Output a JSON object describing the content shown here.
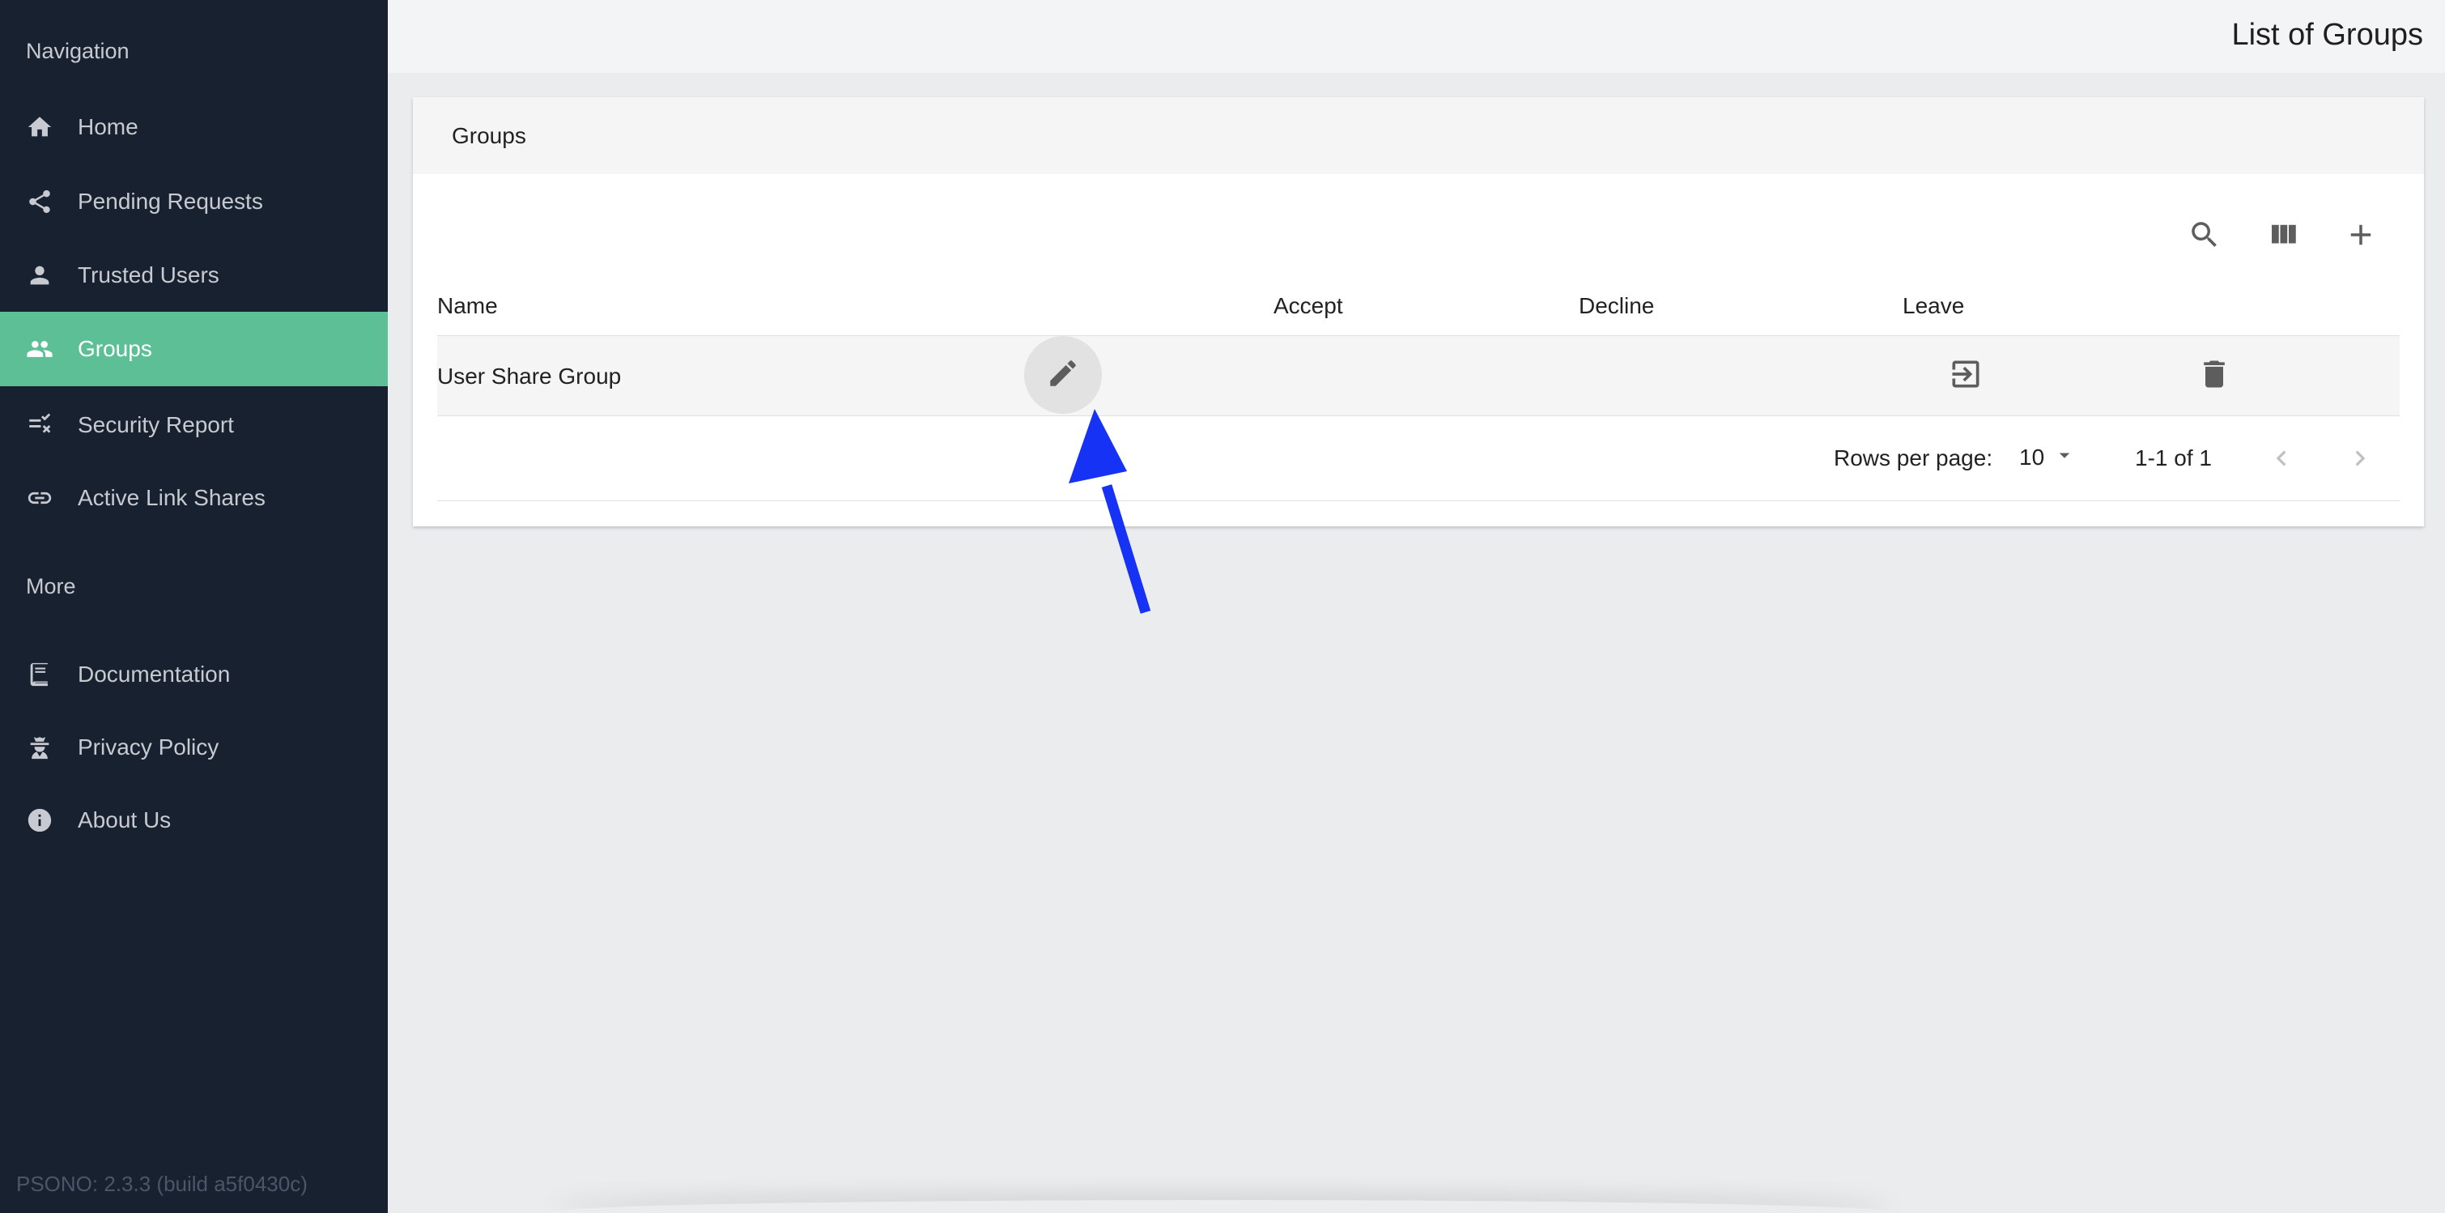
{
  "sidebar": {
    "navigation_heading": "Navigation",
    "more_heading": "More",
    "nav_items": [
      {
        "label": "Home",
        "icon": "home-icon"
      },
      {
        "label": "Pending Requests",
        "icon": "share-icon"
      },
      {
        "label": "Trusted Users",
        "icon": "person-icon"
      },
      {
        "label": "Groups",
        "icon": "group-icon",
        "active": true
      },
      {
        "label": "Security Report",
        "icon": "checklist-icon"
      },
      {
        "label": "Active Link Shares",
        "icon": "link-icon"
      }
    ],
    "more_items": [
      {
        "label": "Documentation",
        "icon": "book-icon"
      },
      {
        "label": "Privacy Policy",
        "icon": "user-secret-icon"
      },
      {
        "label": "About Us",
        "icon": "info-icon"
      }
    ],
    "version": "PSONO: 2.3.3 (build a5f0430c)"
  },
  "topbar": {
    "title": "List of Groups"
  },
  "card": {
    "title": "Groups",
    "toolbar": {
      "search_icon": "search-icon",
      "columns_icon": "view-column-icon",
      "add_icon": "add-icon"
    },
    "columns": [
      "Name",
      "Accept",
      "Decline",
      "Leave"
    ],
    "rows": [
      {
        "name": "User Share Group"
      }
    ],
    "pagination": {
      "rows_per_page_label": "Rows per page:",
      "rows_per_page_value": "10",
      "range": "1-1 of 1"
    }
  },
  "colors": {
    "sidebar_bg": "#18212f",
    "active_item": "#5cbf95",
    "annotation_arrow": "#1632f5"
  }
}
